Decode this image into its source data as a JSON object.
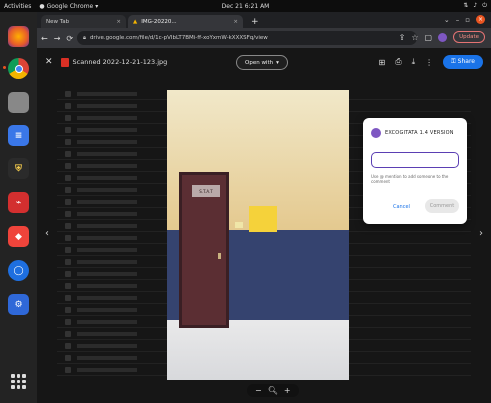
{
  "system_bar": {
    "activities": "Activities",
    "app_name": "Google Chrome",
    "clock": "Dec 21 6:21 AM"
  },
  "dock": {
    "items": [
      "Chrome",
      "Files",
      "Docs",
      "Shield",
      "PDF",
      "AnyDesk",
      "Browser",
      "Tool"
    ]
  },
  "browser": {
    "tabs": [
      {
        "label": "New Tab"
      },
      {
        "label": "IMG-20220..."
      }
    ],
    "url": "drive.google.com/file/d/1c-pVIbLT7BMi-ff-xoYxmW-kXXXSFq/view",
    "update_label": "Update"
  },
  "viewer": {
    "filename": "Scanned 2022-12-21-123.jpg",
    "open_with": "Open with",
    "share": "Share"
  },
  "photo": {
    "door_sign": "S.T.A.T"
  },
  "dialog": {
    "title": "EXCOGITATA 1.4 VERSION",
    "help": "Use @ mention to add someone to the comment",
    "cancel": "Cancel",
    "comment": "Comment"
  },
  "colors": {
    "accent": "#1a73e8",
    "dialog_avatar": "#7e57c2",
    "ubuntu_orange": "#e95420"
  }
}
